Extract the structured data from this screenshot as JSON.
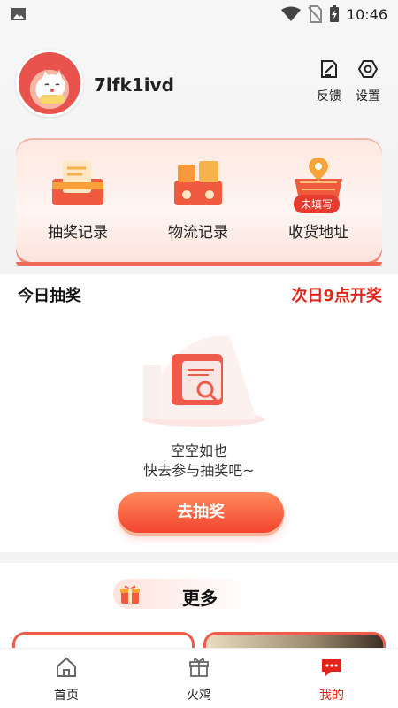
{
  "status_bar": {
    "time": "10:46"
  },
  "profile": {
    "username": "7lfk1ivd"
  },
  "top_actions": {
    "feedback": "反馈",
    "settings": "设置"
  },
  "card_items": [
    {
      "label": "抽奖记录"
    },
    {
      "label": "物流记录"
    },
    {
      "label": "收货地址",
      "badge": "未填写"
    }
  ],
  "lottery": {
    "title": "今日抽奖",
    "note": "次日9点开奖",
    "empty_line1": "空空如也",
    "empty_line2": "快去参与抽奖吧~",
    "button": "去抽奖"
  },
  "more": {
    "title": "更多"
  },
  "tabbar": [
    {
      "label": "首页",
      "icon": "home-icon",
      "active": false
    },
    {
      "label": "火鸡",
      "icon": "gift-box-icon",
      "active": false
    },
    {
      "label": "我的",
      "icon": "chat-bubble-icon",
      "active": true
    }
  ],
  "colors": {
    "accent": "#e2231a",
    "button_top": "#ff8a5c",
    "button_bottom": "#f2452f"
  }
}
